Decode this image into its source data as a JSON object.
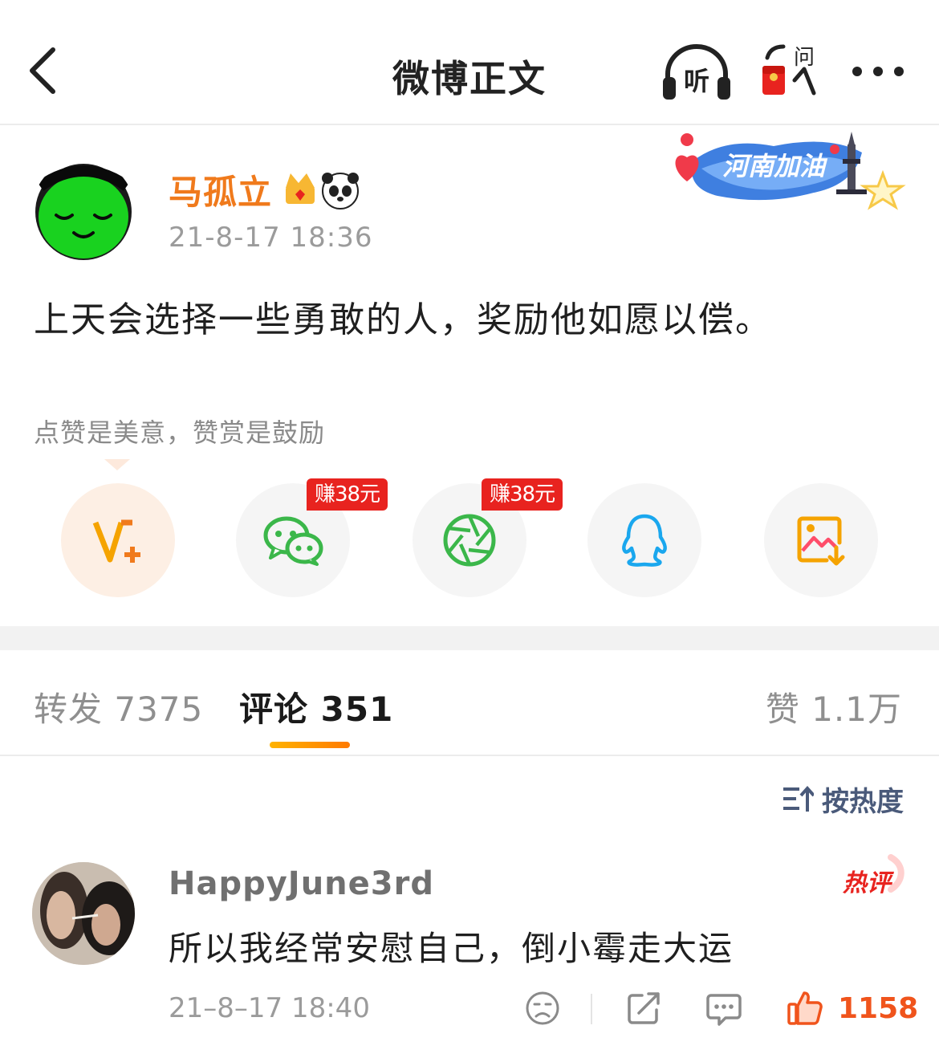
{
  "header": {
    "title": "微博正文",
    "listen_label": "听",
    "ask_label": "问"
  },
  "post": {
    "author": "马孤立",
    "time": "21-8-17 18:36",
    "sticker_text": "河南加油",
    "text": "上天会选择一些勇敢的人，奖励他如愿以偿。",
    "reward_hint": "点赞是美意，赞赏是鼓励"
  },
  "share": {
    "items": [
      {
        "icon": "v-plus-icon"
      },
      {
        "icon": "wechat-icon",
        "badge": "赚38元"
      },
      {
        "icon": "moments-icon",
        "badge": "赚38元"
      },
      {
        "icon": "qq-icon"
      },
      {
        "icon": "save-image-icon"
      }
    ]
  },
  "tabs": {
    "repost": "转发 7375",
    "comment": "评论 351",
    "like": "赞 1.1万"
  },
  "sort": {
    "label": "按热度"
  },
  "comment": {
    "user": "HappyJune3rd",
    "badge": "热评",
    "text": "所以我经常安慰自己，倒小霉走大运",
    "time": "21–8–17 18:40",
    "likes": "1158"
  },
  "colors": {
    "accent_orange": "#f07a1c",
    "like_red": "#f0541c",
    "earn_red": "#e8231f",
    "wechat_green": "#3bb74a",
    "qq_blue": "#1aa7ee",
    "save_orange": "#f5a300"
  }
}
